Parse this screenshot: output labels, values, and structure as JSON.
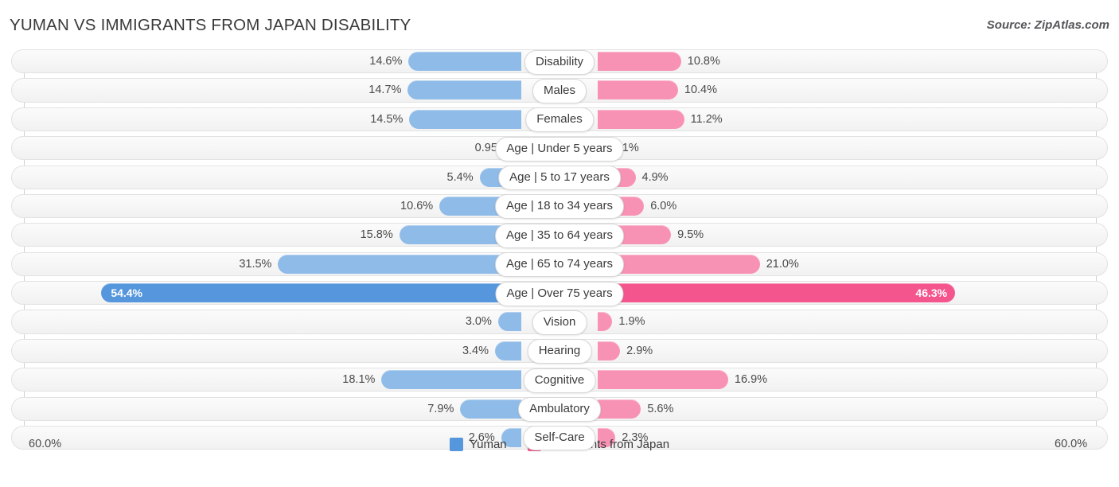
{
  "header": {
    "title": "YUMAN VS IMMIGRANTS FROM JAPAN DISABILITY",
    "source": "Source: ZipAtlas.com"
  },
  "axis": {
    "left_label": "60.0%",
    "right_label": "60.0%"
  },
  "legend": {
    "items": [
      {
        "label": "Yuman",
        "color": "#5596dc"
      },
      {
        "label": "Immigrants from Japan",
        "color": "#f4558d"
      }
    ]
  },
  "chart_data": {
    "type": "bar",
    "title": "YUMAN VS IMMIGRANTS FROM JAPAN DISABILITY",
    "orientation": "horizontal-diverging",
    "xlabel": "",
    "ylabel": "",
    "xlim": [
      -60.0,
      60.0
    ],
    "axis_max": 60.0,
    "grid": true,
    "legend_position": "bottom-center",
    "categories": [
      "Disability",
      "Males",
      "Females",
      "Age | Under 5 years",
      "Age | 5 to 17 years",
      "Age | 18 to 34 years",
      "Age | 35 to 64 years",
      "Age | 65 to 74 years",
      "Age | Over 75 years",
      "Vision",
      "Hearing",
      "Cognitive",
      "Ambulatory",
      "Self-Care"
    ],
    "series": [
      {
        "name": "Yuman",
        "color": "#5596dc",
        "values": [
          14.6,
          14.7,
          14.5,
          0.95,
          5.4,
          10.6,
          15.8,
          31.5,
          54.4,
          3.0,
          3.4,
          18.1,
          7.9,
          2.6
        ],
        "labels": [
          "14.6%",
          "14.7%",
          "14.5%",
          "0.95%",
          "5.4%",
          "10.6%",
          "15.8%",
          "31.5%",
          "54.4%",
          "3.0%",
          "3.4%",
          "18.1%",
          "7.9%",
          "2.6%"
        ]
      },
      {
        "name": "Immigrants from Japan",
        "color": "#f4558d",
        "values": [
          10.8,
          10.4,
          11.2,
          1.1,
          4.9,
          6.0,
          9.5,
          21.0,
          46.3,
          1.9,
          2.9,
          16.9,
          5.6,
          2.3
        ],
        "labels": [
          "10.8%",
          "10.4%",
          "11.2%",
          "1.1%",
          "4.9%",
          "6.0%",
          "9.5%",
          "21.0%",
          "46.3%",
          "1.9%",
          "2.9%",
          "16.9%",
          "5.6%",
          "2.3%"
        ]
      }
    ],
    "highlight_rows": [
      8
    ]
  }
}
